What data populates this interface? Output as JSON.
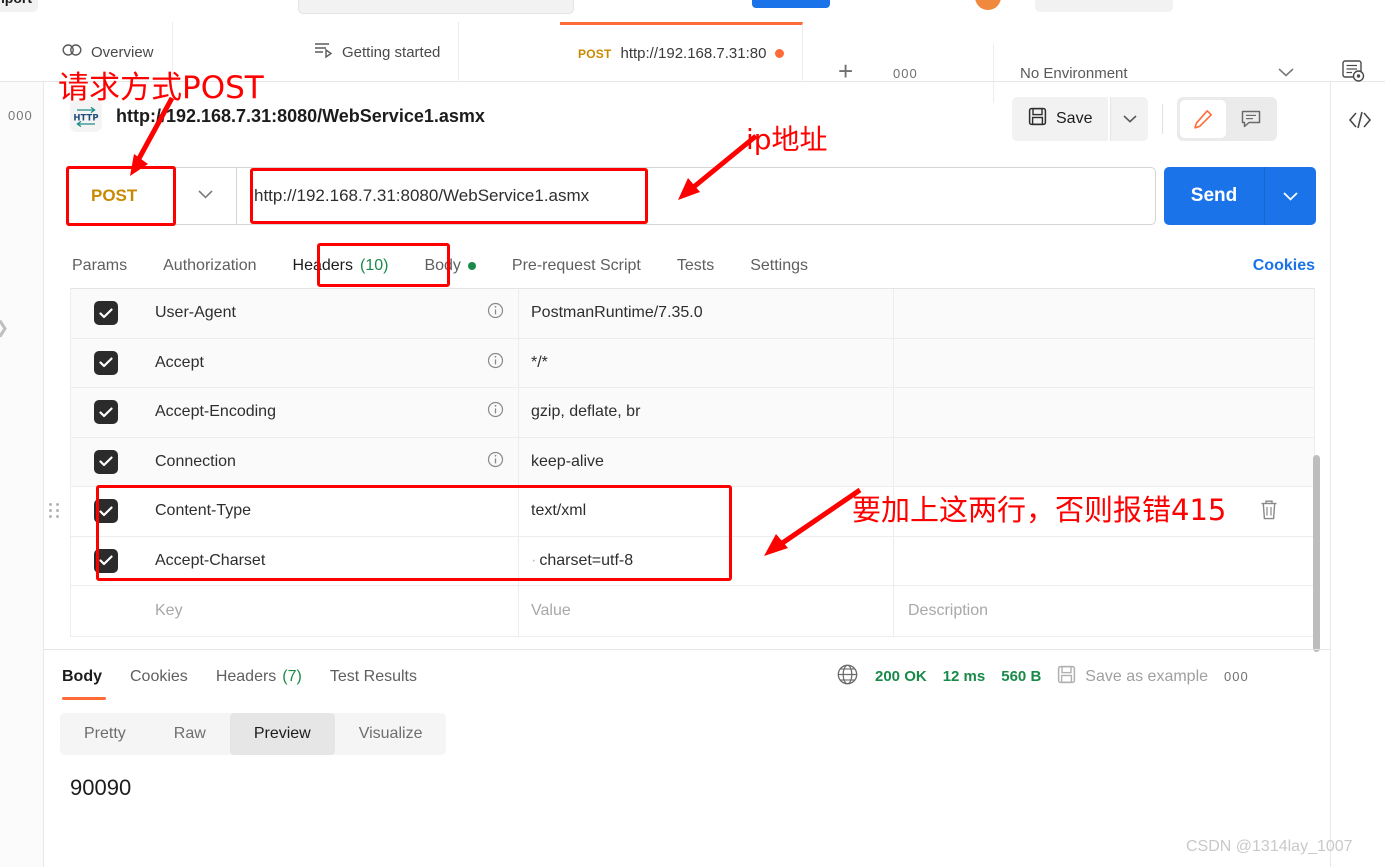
{
  "top_strip": {
    "import_label": "Import"
  },
  "tabbar": {
    "overview_label": "Overview",
    "getting_started_label": "Getting started",
    "active_tab": {
      "method": "POST",
      "url": "http://192.168.7.31:80"
    },
    "more_label": "000",
    "environment_label": "No Environment"
  },
  "left_rail": {
    "more_label": "000"
  },
  "breadcrumb": {
    "protocol_badge": "HTTP",
    "title": "http://192.168.7.31:8080/WebService1.asmx"
  },
  "toolbar": {
    "save_label": "Save"
  },
  "request": {
    "method": "POST",
    "url": "http://192.168.7.31:8080/WebService1.asmx",
    "send_label": "Send"
  },
  "request_tabs": {
    "items": [
      {
        "label": "Params",
        "count": "",
        "active": false
      },
      {
        "label": "Authorization",
        "count": "",
        "active": false
      },
      {
        "label": "Headers",
        "count": "(10)",
        "active": true
      },
      {
        "label": "Body",
        "count": "",
        "active": false
      },
      {
        "label": "Pre-request Script",
        "count": "",
        "active": false
      },
      {
        "label": "Tests",
        "count": "",
        "active": false
      },
      {
        "label": "Settings",
        "count": "",
        "active": false
      }
    ],
    "cookies_label": "Cookies"
  },
  "headers_table": {
    "columns": {
      "key": "Key",
      "value": "Value",
      "description": "Description"
    },
    "rows": [
      {
        "checked": true,
        "key": "User-Agent",
        "value": "PostmanRuntime/7.35.0",
        "description": "",
        "info": true
      },
      {
        "checked": true,
        "key": "Accept",
        "value": "*/*",
        "description": "",
        "info": true
      },
      {
        "checked": true,
        "key": "Accept-Encoding",
        "value": "gzip, deflate, br",
        "description": "",
        "info": true
      },
      {
        "checked": true,
        "key": "Connection",
        "value": "keep-alive",
        "description": "",
        "info": true
      },
      {
        "checked": true,
        "key": "Content-Type",
        "value": "text/xml",
        "description": "",
        "info": false
      },
      {
        "checked": true,
        "key": "Accept-Charset",
        "value": "charset=utf-8",
        "description": "",
        "info": false
      }
    ]
  },
  "response": {
    "tabs": [
      {
        "label": "Body",
        "count": "",
        "active": true
      },
      {
        "label": "Cookies",
        "count": "",
        "active": false
      },
      {
        "label": "Headers",
        "count": "(7)",
        "active": false
      },
      {
        "label": "Test Results",
        "count": "",
        "active": false
      }
    ],
    "status": "200 OK",
    "time": "12 ms",
    "size": "560 B",
    "save_example_label": "Save as example",
    "more_label": "000",
    "viewer_tabs": [
      {
        "label": "Pretty",
        "active": false
      },
      {
        "label": "Raw",
        "active": false
      },
      {
        "label": "Preview",
        "active": true
      },
      {
        "label": "Visualize",
        "active": false
      }
    ],
    "body": "90090"
  },
  "annotations": {
    "method_note": "请求方式POST",
    "ip_note": "ip地址",
    "headers_note": "要加上这两行，否则报错415"
  },
  "watermark": "CSDN @1314lay_1007",
  "colors": {
    "accent": "#ff6c37",
    "send": "#1a73e8",
    "method": "#c98a00",
    "success": "#1a8a4a",
    "annotation": "#ff0000"
  }
}
